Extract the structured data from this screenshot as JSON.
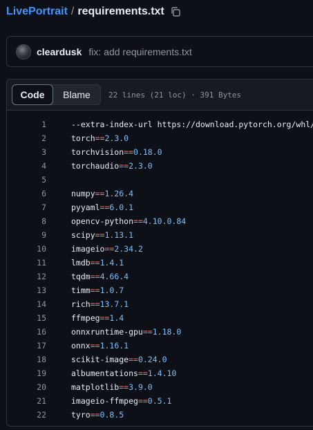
{
  "breadcrumb": {
    "repo": "LivePortrait",
    "separator": "/",
    "file": "requirements.txt"
  },
  "commit": {
    "author": "cleardusk",
    "message": "fix: add requirements.txt"
  },
  "file_header": {
    "tabs": [
      {
        "label": "Code",
        "active": true
      },
      {
        "label": "Blame",
        "active": false
      }
    ],
    "info": "22 lines (21 loc) · 391 Bytes"
  },
  "lines": [
    {
      "num": "1",
      "pkg": "--extra-index-url https://download.pytorch.org/whl/cu",
      "op": "",
      "ver": ""
    },
    {
      "num": "2",
      "pkg": "torch",
      "op": "==",
      "ver": "2.3.0"
    },
    {
      "num": "3",
      "pkg": "torchvision",
      "op": "==",
      "ver": "0.18.0"
    },
    {
      "num": "4",
      "pkg": "torchaudio",
      "op": "==",
      "ver": "2.3.0"
    },
    {
      "num": "5",
      "pkg": "",
      "op": "",
      "ver": ""
    },
    {
      "num": "6",
      "pkg": "numpy",
      "op": "==",
      "ver": "1.26.4"
    },
    {
      "num": "7",
      "pkg": "pyyaml",
      "op": "==",
      "ver": "6.0.1"
    },
    {
      "num": "8",
      "pkg": "opencv-python",
      "op": "==",
      "ver": "4.10.0.84"
    },
    {
      "num": "9",
      "pkg": "scipy",
      "op": "==",
      "ver": "1.13.1"
    },
    {
      "num": "10",
      "pkg": "imageio",
      "op": "==",
      "ver": "2.34.2"
    },
    {
      "num": "11",
      "pkg": "lmdb",
      "op": "==",
      "ver": "1.4.1"
    },
    {
      "num": "12",
      "pkg": "tqdm",
      "op": "==",
      "ver": "4.66.4"
    },
    {
      "num": "13",
      "pkg": "timm",
      "op": "==",
      "ver": "1.0.7"
    },
    {
      "num": "14",
      "pkg": "rich",
      "op": "==",
      "ver": "13.7.1"
    },
    {
      "num": "15",
      "pkg": "ffmpeg",
      "op": "==",
      "ver": "1.4"
    },
    {
      "num": "16",
      "pkg": "onnxruntime-gpu",
      "op": "==",
      "ver": "1.18.0"
    },
    {
      "num": "17",
      "pkg": "onnx",
      "op": "==",
      "ver": "1.16.1"
    },
    {
      "num": "18",
      "pkg": "scikit-image",
      "op": "==",
      "ver": "0.24.0"
    },
    {
      "num": "19",
      "pkg": "albumentations",
      "op": "==",
      "ver": "1.4.10"
    },
    {
      "num": "20",
      "pkg": "matplotlib",
      "op": "==",
      "ver": "3.9.0"
    },
    {
      "num": "21",
      "pkg": "imageio-ffmpeg",
      "op": "==",
      "ver": "0.5.1"
    },
    {
      "num": "22",
      "pkg": "tyro",
      "op": "==",
      "ver": "0.8.5"
    }
  ],
  "colors": {
    "background": "#0d1117",
    "link": "#4493f8",
    "operator": "#ff7b72",
    "version": "#79c0ff"
  },
  "icons": {
    "copy": "copy-icon",
    "avatar": "avatar"
  }
}
